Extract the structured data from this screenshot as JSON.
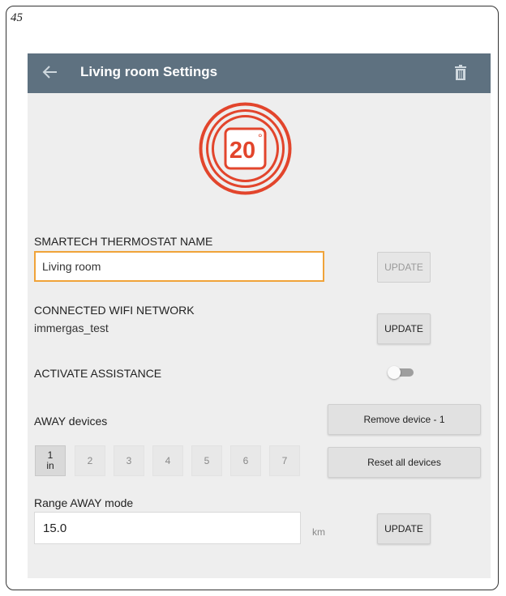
{
  "page_number": "45",
  "header": {
    "title": "Living room Settings",
    "back_icon": "arrow-left-icon",
    "delete_icon": "trash-icon"
  },
  "thermostat": {
    "temperature": "20",
    "unit": "°",
    "accent_color": "#e2452c"
  },
  "name_section": {
    "label": "SMARTECH THERMOSTAT NAME",
    "value": "Living room",
    "update_label": "UPDATE"
  },
  "wifi_section": {
    "label": "CONNECTED WIFI NETWORK",
    "network": "immergas_test",
    "update_label": "UPDATE"
  },
  "assistance": {
    "label": "ACTIVATE ASSISTANCE",
    "enabled": false
  },
  "away": {
    "label": "AWAY devices",
    "remove_label": "Remove device - 1",
    "reset_label": "Reset all devices",
    "devices": [
      {
        "number": "1",
        "sub": "in"
      },
      {
        "number": "2",
        "sub": ""
      },
      {
        "number": "3",
        "sub": ""
      },
      {
        "number": "4",
        "sub": ""
      },
      {
        "number": "5",
        "sub": ""
      },
      {
        "number": "6",
        "sub": ""
      },
      {
        "number": "7",
        "sub": ""
      }
    ]
  },
  "range": {
    "label": "Range AWAY mode",
    "value": "15.0",
    "unit": "km",
    "update_label": "UPDATE"
  }
}
